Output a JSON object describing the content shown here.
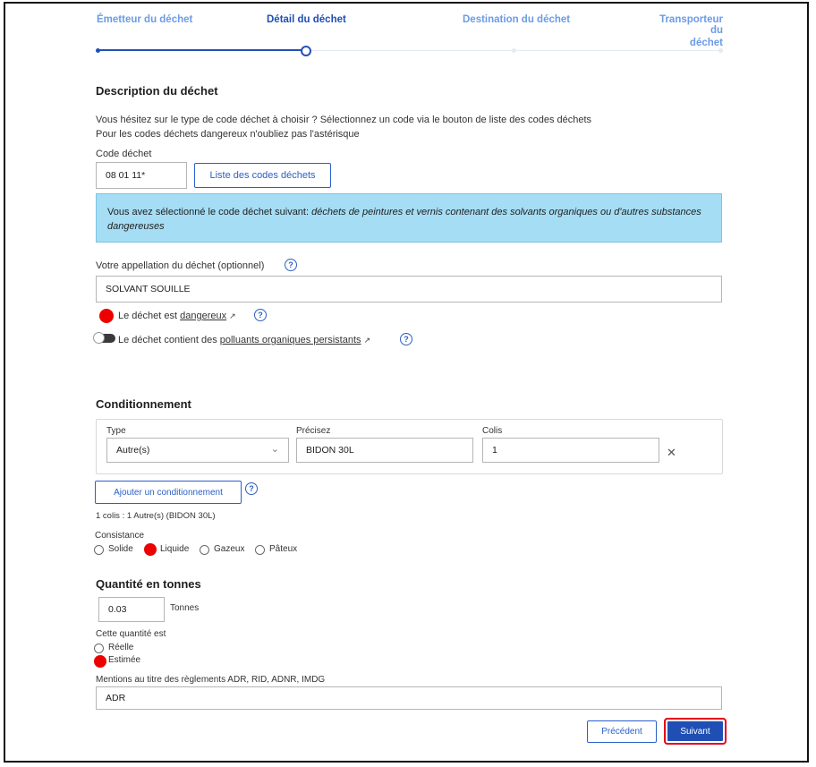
{
  "stepper": {
    "steps": [
      "Émetteur du déchet",
      "Détail du déchet",
      "Destination du déchet",
      "Transporteur du déchet"
    ],
    "step4_line1": "Transporteur du",
    "step4_line2": "déchet",
    "active_index": 1
  },
  "description": {
    "title": "Description du déchet",
    "hint1": "Vous hésitez sur le type de code déchet à choisir ? Sélectionnez un code via le bouton de liste des codes déchets",
    "hint2": "Pour les codes déchets dangereux n'oubliez pas l'astérisque",
    "code_label": "Code déchet",
    "code_value": "08 01 11*",
    "list_button": "Liste des codes déchets",
    "info_prefix": "Vous avez sélectionné le code déchet suivant: ",
    "info_italic": "déchets de peintures et vernis contenant des solvants organiques ou d'autres substances dangereuses",
    "appellation_label": "Votre appellation du déchet (optionnel)",
    "appellation_value": "SOLVANT SOUILLE",
    "dangerous_prefix": "Le déchet est ",
    "dangerous_link": "dangereux",
    "pop_prefix": "Le déchet contient des ",
    "pop_link": "polluants organiques persistants",
    "help_glyph": "?",
    "ext_glyph": "↗"
  },
  "packaging": {
    "title": "Conditionnement",
    "type_label": "Type",
    "type_value": "Autre(s)",
    "precise_label": "Précisez",
    "precise_value": "BIDON 30L",
    "colis_label": "Colis",
    "colis_value": "1",
    "add_button": "Ajouter un conditionnement",
    "summary": "1 colis : 1 Autre(s) (BIDON 30L)",
    "remove_glyph": "✕",
    "chevron_glyph": "⌄"
  },
  "consistency": {
    "label": "Consistance",
    "options": [
      "Solide",
      "Liquide",
      "Gazeux",
      "Pâteux"
    ],
    "selected": "Liquide"
  },
  "quantity": {
    "title": "Quantité en tonnes",
    "value": "0.03",
    "unit": "Tonnes",
    "nature_label": "Cette quantité est",
    "options": [
      "Réelle",
      "Estimée"
    ],
    "selected": "Estimée",
    "adr_label": "Mentions au titre des règlements ADR, RID, ADNR, IMDG",
    "adr_value": "ADR"
  },
  "actions": {
    "previous": "Précédent",
    "next": "Suivant"
  },
  "colors": {
    "primary": "#1f4fb4",
    "info_bg": "#a5ddf5",
    "marker_red": "#ee0000"
  }
}
